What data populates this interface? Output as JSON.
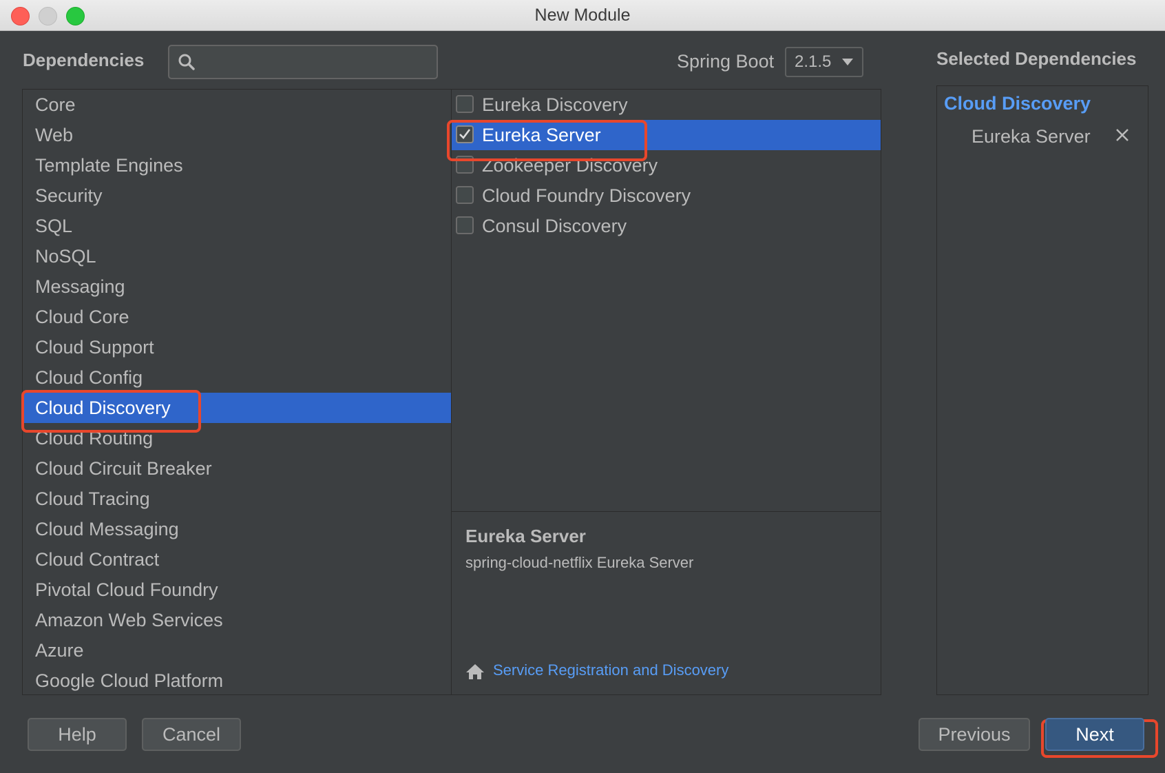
{
  "window": {
    "title": "New Module"
  },
  "header": {
    "dependencies_label": "Dependencies",
    "search": {
      "value": "",
      "placeholder": ""
    },
    "spring_boot_label": "Spring Boot",
    "spring_boot_version": "2.1.5",
    "selected_dependencies_label": "Selected Dependencies"
  },
  "categories": [
    {
      "label": "Core",
      "selected": false
    },
    {
      "label": "Web",
      "selected": false
    },
    {
      "label": "Template Engines",
      "selected": false
    },
    {
      "label": "Security",
      "selected": false
    },
    {
      "label": "SQL",
      "selected": false
    },
    {
      "label": "NoSQL",
      "selected": false
    },
    {
      "label": "Messaging",
      "selected": false
    },
    {
      "label": "Cloud Core",
      "selected": false
    },
    {
      "label": "Cloud Support",
      "selected": false
    },
    {
      "label": "Cloud Config",
      "selected": false
    },
    {
      "label": "Cloud Discovery",
      "selected": true
    },
    {
      "label": "Cloud Routing",
      "selected": false
    },
    {
      "label": "Cloud Circuit Breaker",
      "selected": false
    },
    {
      "label": "Cloud Tracing",
      "selected": false
    },
    {
      "label": "Cloud Messaging",
      "selected": false
    },
    {
      "label": "Cloud Contract",
      "selected": false
    },
    {
      "label": "Pivotal Cloud Foundry",
      "selected": false
    },
    {
      "label": "Amazon Web Services",
      "selected": false
    },
    {
      "label": "Azure",
      "selected": false
    },
    {
      "label": "Google Cloud Platform",
      "selected": false
    }
  ],
  "dependencies": [
    {
      "label": "Eureka Discovery",
      "checked": false,
      "selected": false
    },
    {
      "label": "Eureka Server",
      "checked": true,
      "selected": true
    },
    {
      "label": "Zookeeper Discovery",
      "checked": false,
      "selected": false
    },
    {
      "label": "Cloud Foundry Discovery",
      "checked": false,
      "selected": false
    },
    {
      "label": "Consul Discovery",
      "checked": false,
      "selected": false
    }
  ],
  "description": {
    "title": "Eureka Server",
    "text": "spring-cloud-netflix Eureka Server",
    "link_icon": "home-icon",
    "link_text": "Service Registration and Discovery"
  },
  "selected": {
    "group": "Cloud Discovery",
    "items": [
      {
        "label": "Eureka Server",
        "remove_icon": "close-icon"
      }
    ]
  },
  "buttons": {
    "help": "Help",
    "cancel": "Cancel",
    "previous": "Previous",
    "next": "Next"
  },
  "colors": {
    "background": "#3c3f41",
    "selection": "#2f65ca",
    "link": "#589df6",
    "highlight": "#e8472c",
    "default_button": "#365880"
  }
}
